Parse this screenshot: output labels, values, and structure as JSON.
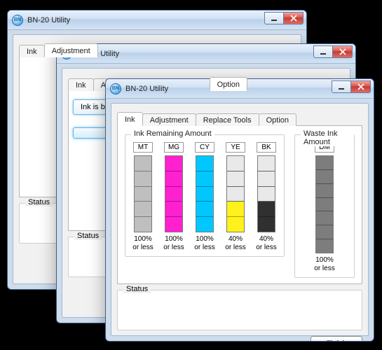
{
  "app_title": "BN-20 Utility",
  "tabs": {
    "ink": "Ink",
    "adjustment": "Adjustment",
    "replace": "Replace Tools",
    "option": "Option"
  },
  "status_label": "Status",
  "finish_label": "Finish",
  "option_partial_button": "Ink is b",
  "ink_panel": {
    "remaining_label": "Ink Remaining Amount",
    "waste_label": "Waste Ink Amount",
    "orless": "or less",
    "columns": [
      {
        "code": "MT",
        "pct": 100,
        "color": "#bfbfbf",
        "segments": 5
      },
      {
        "code": "MG",
        "pct": 100,
        "color": "#ff20d0",
        "segments": 5
      },
      {
        "code": "CY",
        "pct": 100,
        "color": "#00c8ff",
        "segments": 5
      },
      {
        "code": "YE",
        "pct": 40,
        "color": "#fff21a",
        "segments": 5
      },
      {
        "code": "BK",
        "pct": 40,
        "color": "#303030",
        "segments": 5
      }
    ],
    "waste": {
      "code": "DM",
      "pct": 100,
      "color": "#7d7d7d",
      "segments": 7
    }
  },
  "chart_data": {
    "type": "bar",
    "title": "Ink Remaining Amount",
    "ylabel": "% or less",
    "ylim": [
      0,
      100
    ],
    "categories": [
      "MT",
      "MG",
      "CY",
      "YE",
      "BK"
    ],
    "values": [
      100,
      100,
      100,
      40,
      40
    ],
    "series": [
      {
        "name": "Waste Ink Amount",
        "categories": [
          "DM"
        ],
        "values": [
          100
        ]
      }
    ]
  }
}
